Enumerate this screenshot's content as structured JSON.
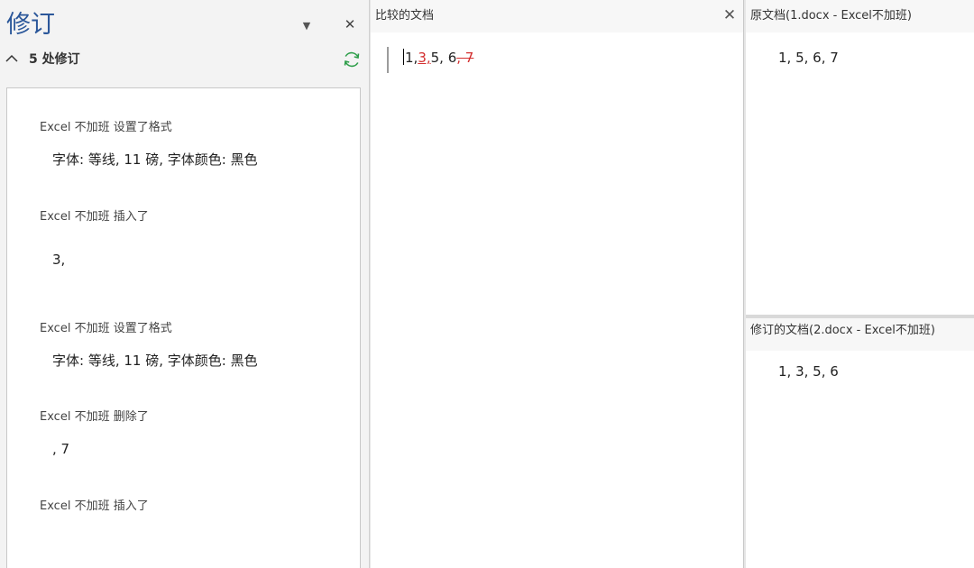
{
  "revisions_pane": {
    "title": "修订",
    "count_label": "5 处修订",
    "items": [
      {
        "head": "Excel 不加班  设置了格式",
        "body": "字体: 等线, 11  磅,  字体颜色:  黑色"
      },
      {
        "head": "Excel 不加班  插入了",
        "body": "3,"
      },
      {
        "head": "Excel 不加班  设置了格式",
        "body": "字体: 等线, 11  磅,  字体颜色:  黑色"
      },
      {
        "head": "Excel 不加班  删除了",
        "body": ",  7"
      },
      {
        "head": "Excel 不加班  插入了",
        "body": ""
      }
    ]
  },
  "compared_doc": {
    "title": "比较的文档",
    "parts": {
      "p1": "1,  ",
      "ins": "3,  ",
      "p2": "5,  6",
      "del": ",  7"
    }
  },
  "original_doc": {
    "title": "原文档(1.docx - Excel不加班)",
    "text": "1,  5,  6,  7"
  },
  "revised_doc": {
    "title": "修订的文档(2.docx - Excel不加班)",
    "text": "1,  3,  5,  6"
  },
  "colors": {
    "title_blue": "#2b579a",
    "revision_red": "#d32f2f",
    "refresh_green": "#2e9e4a"
  },
  "icons": [
    "chevron-up-icon",
    "dropdown-arrow-icon",
    "close-icon",
    "refresh-icon"
  ]
}
